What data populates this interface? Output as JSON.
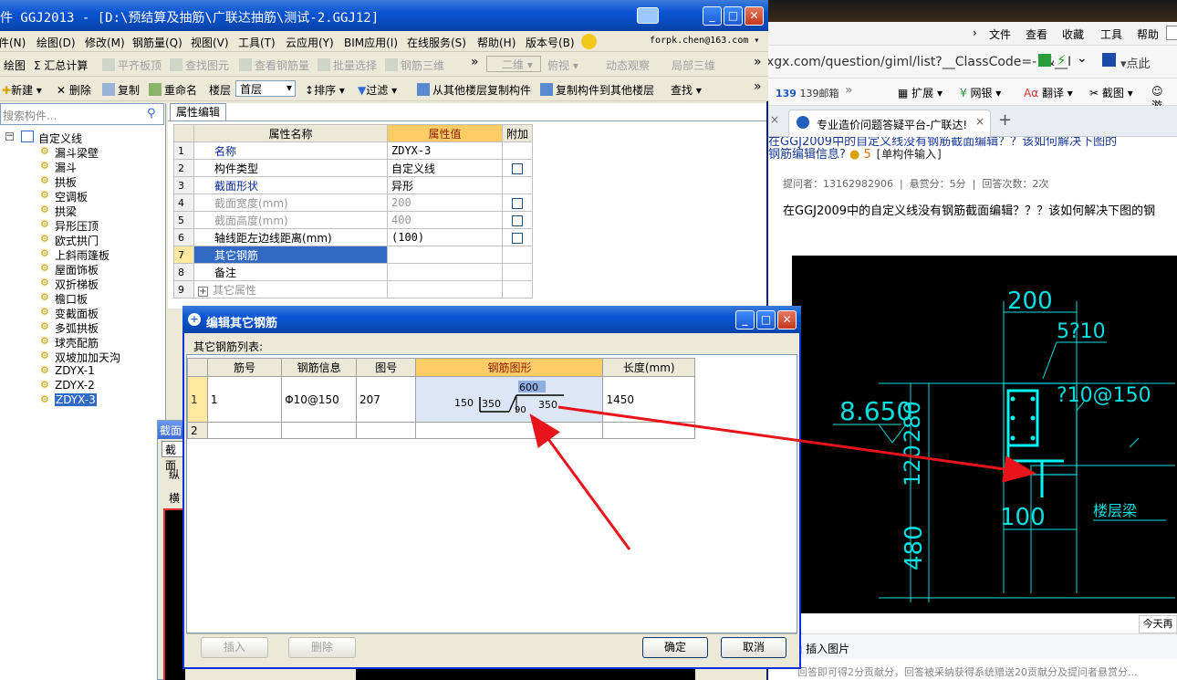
{
  "ggj": {
    "title": "件 GGJ2013 - [D:\\预结算及抽筋\\广联达抽筋\\测试-2.GGJ12]",
    "menu": [
      "件(N)",
      "绘图(D)",
      "修改(M)",
      "钢筋量(Q)",
      "视图(V)",
      "工具(T)",
      "云应用(Y)",
      "BIM应用(I)",
      "在线服务(S)",
      "帮助(H)",
      "版本号(B)"
    ],
    "account": "forpk.chen@163.com",
    "toolbar1": {
      "draw": "绘图",
      "sum": "Σ 汇总计算",
      "flat": "平齐板顶",
      "find_elem": "查找图元",
      "view_rebar": "查看钢筋量",
      "batch": "批量选择",
      "rebar3d": "钢筋三维",
      "mode2d": "二维",
      "view": "俯视",
      "dyn": "动态观察",
      "local3d": "局部三维"
    },
    "toolbar2": {
      "new": "新建",
      "delete": "删除",
      "copy": "复制",
      "rename": "重命名",
      "floor_label": "楼层",
      "floor_value": "首层",
      "sort": "排序",
      "filter": "过滤",
      "copy_from": "从其他楼层复制构件",
      "copy_to": "复制构件到其他楼层",
      "find": "查找"
    },
    "search_placeholder": "搜索构件...",
    "tree_root": "自定义线",
    "tree_items": [
      "漏斗梁壁",
      "漏斗",
      "拱板",
      "空调板",
      "拱梁",
      "异形压顶",
      "欧式拱门",
      "上斜雨篷板",
      "屋面饰板",
      "双折梯板",
      "檐口板",
      "变截面板",
      "多弧拱板",
      "球壳配筋",
      "双坡加加天沟",
      "ZDYX-1",
      "ZDYX-2",
      "ZDYX-3"
    ],
    "prop_tab": "属性编辑",
    "prop_headers": [
      "属性名称",
      "属性值",
      "附加"
    ],
    "prop_rows": [
      {
        "n": "1",
        "name": "名称",
        "value": "ZDYX-3"
      },
      {
        "n": "2",
        "name": "构件类型",
        "value": "自定义线"
      },
      {
        "n": "3",
        "name": "截面形状",
        "value": "异形"
      },
      {
        "n": "4",
        "name": "截面宽度(mm)",
        "value": "200"
      },
      {
        "n": "5",
        "name": "截面高度(mm)",
        "value": "400"
      },
      {
        "n": "6",
        "name": "轴线距左边线距离(mm)",
        "value": "(100)"
      },
      {
        "n": "7",
        "name": "其它钢筋",
        "value": ""
      },
      {
        "n": "8",
        "name": "备注",
        "value": ""
      },
      {
        "n": "9",
        "name": "其它属性",
        "value": ""
      }
    ],
    "side_panel_title": "截面",
    "side_tab": "截面",
    "side_row1": "纵",
    "side_row2": "横"
  },
  "dialog": {
    "title": "编辑其它钢筋",
    "list_label": "其它钢筋列表:",
    "headers": [
      "筋号",
      "钢筋信息",
      "图号",
      "钢筋图形",
      "长度(mm)"
    ],
    "rows": [
      {
        "n": "1",
        "no": "1",
        "info": "Φ10@150",
        "fig": "207",
        "len": "1450"
      },
      {
        "n": "2",
        "no": "",
        "info": "",
        "fig": "",
        "len": ""
      }
    ],
    "shape": {
      "top": "600",
      "left": "150",
      "mid": "350",
      "right": "350",
      "angle": "90"
    },
    "btn_insert": "插入",
    "btn_delete": "删除",
    "btn_ok": "确定",
    "btn_cancel": "取消"
  },
  "browser": {
    "menu": [
      "文件",
      "查看",
      "收藏",
      "工具",
      "帮助"
    ],
    "address": "xgx.com/question/giml/list?__ClassCode=-1&__I",
    "fav": [
      "139邮箱",
      "扩展",
      "网银",
      "翻译",
      "截图",
      "游"
    ],
    "tab_title": "专业造价问题答疑平台-广联达!",
    "question_line1": "在GGJ2009中的自定义线没有钢筋截面编辑？？该如何解决下图的",
    "question_line2": "钢筋编辑信息?",
    "reward_icon_num": "5",
    "tag": "[单构件输入]",
    "meta": "提问者：13162982906  |  悬赏分：5分  |  回答次数：2次",
    "question_body": "在GGJ2009中的自定义线没有钢筋截面编辑？？？该如何解决下图的钢",
    "drawing": {
      "w200": "200",
      "stirrup": "5?10",
      "elev": "8.650",
      "h280": "280",
      "h120": "120",
      "rebar": "?10@150",
      "w100": "100",
      "h480": "480",
      "label": "楼层梁"
    },
    "today_tab": "今天再",
    "insert_image": "插入图片",
    "footer_note": "回答即可得2分贡献分，回答被采纳获得系统赠送20贡献分及提问者悬赏分..."
  },
  "colors": {
    "title_blue": "#0a55d4",
    "accent_orange": "#ffcc66",
    "arrow_red": "#e8141c",
    "cad_cyan": "#00e0e0",
    "cad_bg": "#000000"
  }
}
